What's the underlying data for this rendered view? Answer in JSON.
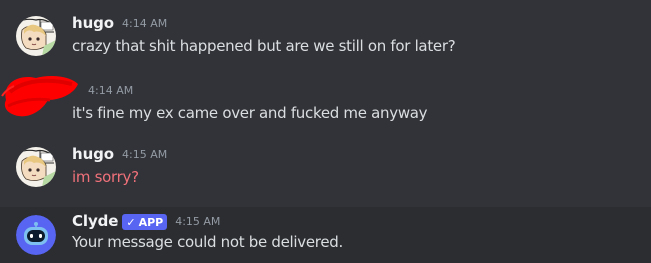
{
  "messages": [
    {
      "author": "hugo",
      "time": "4:14 AM",
      "text": "crazy that shit happened but are we still on for later?",
      "avatar_icon": "anime-character-avatar-icon"
    },
    {
      "author": "",
      "time": "4:14 AM",
      "text": "it's fine my ex came over and fucked me anyway",
      "avatar_icon": "redacted-scribble-icon",
      "redaction_color": "#ff0000"
    },
    {
      "author": "hugo",
      "time": "4:15 AM",
      "text": "im sorry?",
      "text_color": "#f0717a",
      "avatar_icon": "anime-character-avatar-icon"
    },
    {
      "author": "Clyde",
      "badge": "APP",
      "badge_icon": "checkmark-icon",
      "time": "4:15 AM",
      "text": "Your message could not be delivered.",
      "avatar_icon": "clyde-bot-avatar-icon"
    }
  ],
  "colors": {
    "background": "#313338",
    "system_row_background": "#2b2d31",
    "username": "#f2f3f5",
    "timestamp": "#949ba4",
    "message_text": "#dbdee1",
    "badge": "#5865f2",
    "failed_text": "#f0717a"
  }
}
